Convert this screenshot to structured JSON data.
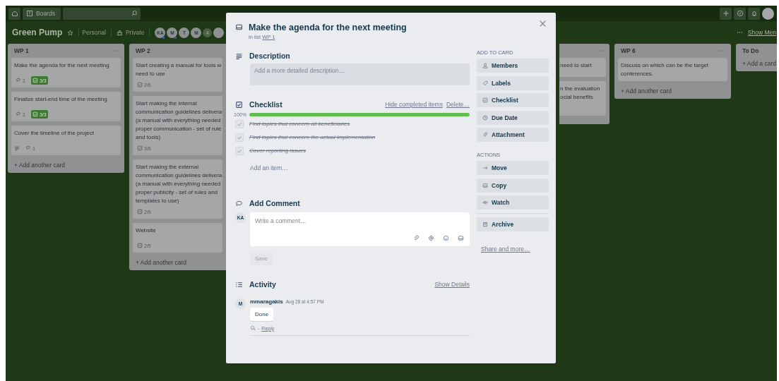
{
  "top_bar": {
    "boards_label": "Boards"
  },
  "board_header": {
    "title": "Green Pump",
    "team": "Personal",
    "visibility": "Private",
    "members": [
      {
        "initials": "KA",
        "admin": true
      },
      {
        "initials": "M",
        "admin": true
      },
      {
        "initials": "T",
        "admin": false
      },
      {
        "initials": "M",
        "admin": false
      }
    ],
    "more_count": "4",
    "menu_label": "Show Men"
  },
  "lists": [
    {
      "title": "WP 1",
      "menu": true,
      "cards": [
        {
          "title": "Make the agenda for the next meeting",
          "badges": [
            {
              "kind": "comment",
              "text": "1"
            },
            {
              "kind": "checklist",
              "text": "3/3",
              "complete": true
            }
          ]
        },
        {
          "title": "Finalize start-end time of the meeting",
          "badges": [
            {
              "kind": "comment",
              "text": "1"
            },
            {
              "kind": "checklist",
              "text": "3/3",
              "complete": true
            }
          ]
        },
        {
          "title": "Cover the timeline of the project",
          "badges": [
            {
              "kind": "description"
            },
            {
              "kind": "comment",
              "text": "1"
            }
          ]
        }
      ],
      "add_label": "+ Add another card"
    },
    {
      "title": "WP 2",
      "menu": false,
      "cards": [
        {
          "title": "Start creating a manual for tools w\nneed to use",
          "badges": [
            {
              "kind": "checklist",
              "text": "2/6",
              "complete": false
            }
          ]
        },
        {
          "title": "Start making the internal\ncommunication guidelines delivera\n(a manual with everything needed\nproper communication - set of rule\nand tools)",
          "badges": [
            {
              "kind": "checklist",
              "text": "3/6",
              "complete": false
            }
          ]
        },
        {
          "title": "Start making the external\ncommunication guidelines delivera\n(a manual with everything needed\nproper publicity - set of rules and\ntemplates to use)",
          "badges": [
            {
              "kind": "checklist",
              "text": "2/6",
              "complete": false
            }
          ]
        },
        {
          "title": "Website",
          "badges": [
            {
              "kind": "checklist",
              "text": "2/5",
              "complete": false
            }
          ]
        }
      ],
      "add_label": "+ Add another card"
    },
    {
      "menu": true,
      "cards": [
        {
          "title": "need to start"
        },
        {
          "title": "n the evaluation\nocial benefits"
        }
      ]
    },
    {
      "title": "WP 6",
      "menu": true,
      "cards": [
        {
          "title": "Discuss on which can be the target\nconferences."
        }
      ],
      "add_label": "+ Add another card"
    },
    {
      "title": "To Do",
      "menu": false,
      "add_label": "+ Add a card"
    }
  ],
  "card_detail": {
    "title": "Make the agenda for the next meeting",
    "list_prefix": "in list",
    "list_link": "WP 1",
    "description": {
      "heading": "Description",
      "placeholder": "Add a more detailed description…"
    },
    "checklist": {
      "heading": "Checklist",
      "hide_link": "Hide completed items",
      "delete_link": "Delete…",
      "percent": "100%",
      "level": 1,
      "items": [
        {
          "text": "Find topics that concern all beneficiaries",
          "checked": true
        },
        {
          "text": "Find topics that concern the actual implementation",
          "checked": true
        },
        {
          "text": "Cover reporting issues",
          "checked": true
        }
      ],
      "add_item": "Add an item…"
    },
    "comment": {
      "heading": "Add Comment",
      "avatar": "KA",
      "placeholder": "Write a comment…",
      "save": "Save",
      "save_disabled": true
    },
    "activity": {
      "heading": "Activity",
      "details_link": "Show Details",
      "entries": [
        {
          "avatar": "M",
          "author": "mmaragakis",
          "time": "Aug 28 at 4:57 PM",
          "text": "Done",
          "separator": "-",
          "reply": "Reply"
        }
      ]
    },
    "sidebar": {
      "sections": [
        {
          "heading": "ADD TO CARD",
          "buttons": [
            {
              "kind": "members",
              "label": "Members",
              "separated": false
            },
            {
              "kind": "labels",
              "label": "Labels",
              "separated": false
            },
            {
              "kind": "checklist",
              "label": "Checklist",
              "separated": false
            },
            {
              "kind": "due_date",
              "label": "Due Date",
              "separated": false
            },
            {
              "kind": "attachment",
              "label": "Attachment",
              "separated": false
            }
          ]
        },
        {
          "heading": "ACTIONS",
          "buttons": [
            {
              "kind": "move",
              "label": "Move",
              "separated": false
            },
            {
              "kind": "copy",
              "label": "Copy",
              "separated": false
            },
            {
              "kind": "watch",
              "label": "Watch",
              "separated": false
            },
            {
              "kind": "archive",
              "label": "Archive",
              "separated": true
            }
          ]
        }
      ],
      "share_link": "Share and more…"
    }
  }
}
